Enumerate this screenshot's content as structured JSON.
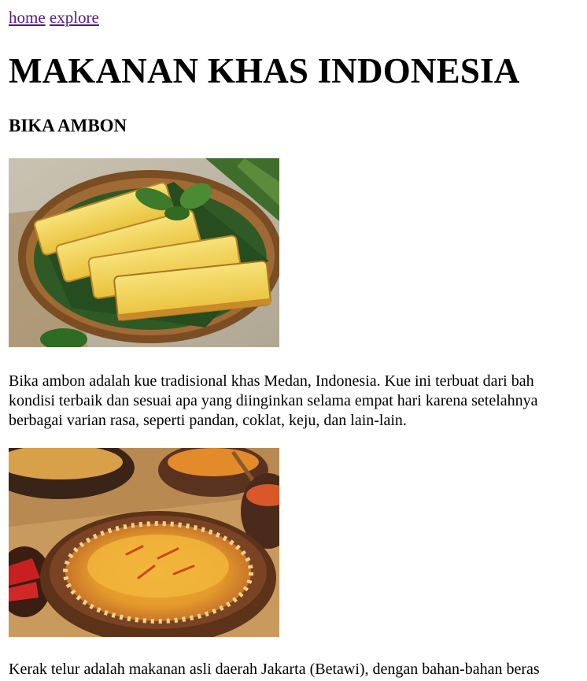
{
  "nav": {
    "home_label": "home",
    "explore_label": "explore"
  },
  "page_title": "MAKANAN KHAS INDONESIA",
  "section": {
    "heading": "BIKA AMBON"
  },
  "articles": [
    {
      "image_icon": "bika-ambon-photo",
      "lines": [
        "Bika ambon adalah kue tradisional khas Medan, Indonesia. Kue ini terbuat dari bah",
        "kondisi terbaik dan sesuai apa yang diinginkan selama empat hari karena setelahnya",
        "berbagai varian rasa, seperti pandan, coklat, keju, dan lain-lain."
      ]
    },
    {
      "image_icon": "kerak-telor-photo",
      "lines": [
        "Kerak telur adalah makanan asli daerah Jakarta (Betawi), dengan bahan-bahan beras"
      ]
    }
  ],
  "colors": {
    "link_visited": "#551a8b",
    "text": "#000000",
    "background": "#ffffff"
  }
}
